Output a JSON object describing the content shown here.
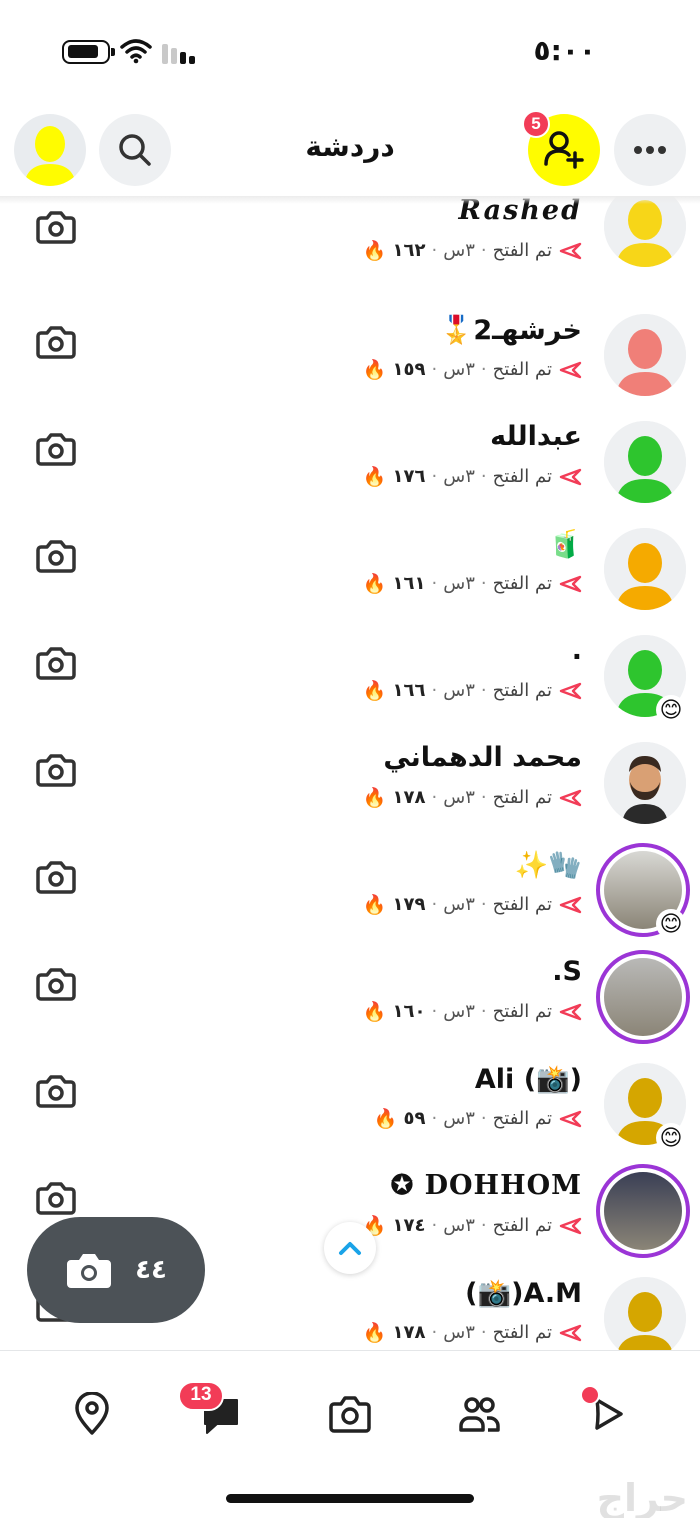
{
  "status_bar": {
    "time": "٥:٠٠"
  },
  "header": {
    "title": "دردشة",
    "add_friend_badge": "5"
  },
  "chats": [
    {
      "name": "Rashed",
      "status": "تم الفتح",
      "time": "٣س",
      "streak": "١٦٢",
      "avatar_color": "#f7d618",
      "story": false,
      "emoji": ""
    },
    {
      "name": "خرشهـ2🎖️",
      "status": "تم الفتح",
      "time": "٣س",
      "streak": "١٥٩",
      "avatar_color": "#f07f78",
      "story": false,
      "emoji": ""
    },
    {
      "name": "عبدالله",
      "status": "تم الفتح",
      "time": "٣س",
      "streak": "١٧٦",
      "avatar_color": "#2ec52e",
      "story": false,
      "emoji": ""
    },
    {
      "name": "🧃",
      "status": "تم الفتح",
      "time": "٣س",
      "streak": "١٦١",
      "avatar_color": "#f5aa00",
      "story": false,
      "emoji": ""
    },
    {
      "name": ".",
      "status": "تم الفتح",
      "time": "٣س",
      "streak": "١٦٦",
      "avatar_color": "#2ec52e",
      "story": false,
      "emoji": "😊"
    },
    {
      "name": "محمد الدهماني",
      "status": "تم الفتح",
      "time": "٣س",
      "streak": "١٧٨",
      "avatar_color": "#e9ecef",
      "story": false,
      "emoji": ""
    },
    {
      "name": "🧤✨",
      "status": "تم الفتح",
      "time": "٣س",
      "streak": "١٧٩",
      "avatar_color": "#d8d8d4",
      "story": true,
      "emoji": "😊"
    },
    {
      "name": "S.",
      "status": "تم الفتح",
      "time": "٣س",
      "streak": "١٦٠",
      "avatar_color": "#b9b9b7",
      "story": true,
      "emoji": ""
    },
    {
      "name": "(📸) Ali",
      "status": "تم الفتح",
      "time": "٣س",
      "streak": "٥٩",
      "avatar_color": "#d5a600",
      "story": false,
      "emoji": "😊"
    },
    {
      "name": "DOHHOM ✪",
      "status": "تم الفتح",
      "time": "٣س",
      "streak": "١٧٤",
      "avatar_color": "#3a3f55",
      "story": true,
      "emoji": ""
    },
    {
      "name": "A.M(📸)",
      "status": "تم الفتح",
      "time": "٣س",
      "streak": "١٧٨",
      "avatar_color": "#d5a600",
      "story": false,
      "emoji": ""
    }
  ],
  "floating_camera": {
    "count": "٤٤"
  },
  "bottom_nav": {
    "chat_badge": "13",
    "items": [
      "map-icon",
      "chat-icon",
      "camera-icon",
      "friends-icon",
      "spotlight-icon"
    ]
  },
  "watermark": "حراج",
  "colors": {
    "snap_yellow": "#fffc00",
    "badge_red": "#f23c57",
    "story_ring": "#9b35d6",
    "sent_arrow": "#f23c57"
  }
}
